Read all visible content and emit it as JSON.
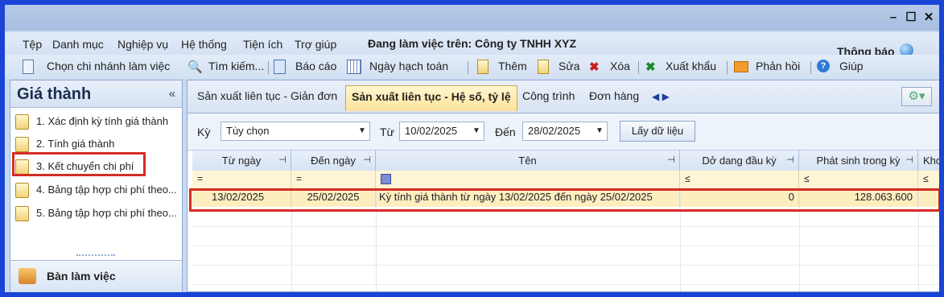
{
  "window": {
    "minimize": "–",
    "maximize": "☐",
    "close": "✕"
  },
  "menu": {
    "items": [
      "Tệp",
      "Danh mục",
      "Nghiệp vụ",
      "Hệ thống",
      "Tiện ích",
      "Trợ giúp"
    ],
    "company": "Đang làm việc trên: Công ty TNHH XYZ"
  },
  "notice": {
    "label": "Thông báo",
    "icon": "globe-icon"
  },
  "toolbar": {
    "choose_branch": "Chọn chi nhánh làm việc",
    "search": "Tìm kiếm...",
    "report": "Báo cáo",
    "accounting_date": "Ngày hạch toán",
    "add": "Thêm",
    "edit": "Sửa",
    "delete": "Xóa",
    "export": "Xuất khẩu",
    "feedback": "Phản hồi",
    "help": "Giúp"
  },
  "left_panel": {
    "title": "Giá thành",
    "collapse": "«",
    "items": [
      "1. Xác định kỳ tính giá thành",
      "2. Tính giá thành",
      "3. Kết chuyển chi phí",
      "4. Bảng tập hợp chi phí theo...",
      "5. Bảng tập hợp chi phí theo..."
    ],
    "desk": "Bàn làm việc"
  },
  "tabs": {
    "items": [
      "Sản xuất liên tục - Giản đơn",
      "Sản xuất liên tục - Hệ số, tỷ lệ",
      "Công trình",
      "Đơn hàng"
    ],
    "active_index": 1,
    "arrows": "◀ ▶"
  },
  "filter": {
    "period_label": "Kỳ",
    "period_value": "Tùy chọn",
    "from_label": "Từ",
    "from_value": "10/02/2025",
    "to_label": "Đến",
    "to_value": "28/02/2025",
    "fetch_button": "Lấy dữ liệu"
  },
  "grid": {
    "columns": [
      "Từ ngày",
      "Đến ngày",
      "Tên",
      "Dở dang đầu kỳ",
      "Phát sinh trong kỳ",
      "Khoả"
    ],
    "filter_ops": [
      "=",
      "=",
      "",
      "≤",
      "≤",
      "≤"
    ],
    "rows": [
      {
        "from": "13/02/2025",
        "to": "25/02/2025",
        "name": "Kỳ tính giá thành từ ngày 13/02/2025 đến ngày 25/02/2025",
        "opening": "0",
        "incurred": "128.063.600"
      }
    ]
  },
  "colors": {
    "highlight_red": "#d42d25",
    "row_selected": "#fdeec0",
    "frame_blue": "#1a44d6"
  }
}
